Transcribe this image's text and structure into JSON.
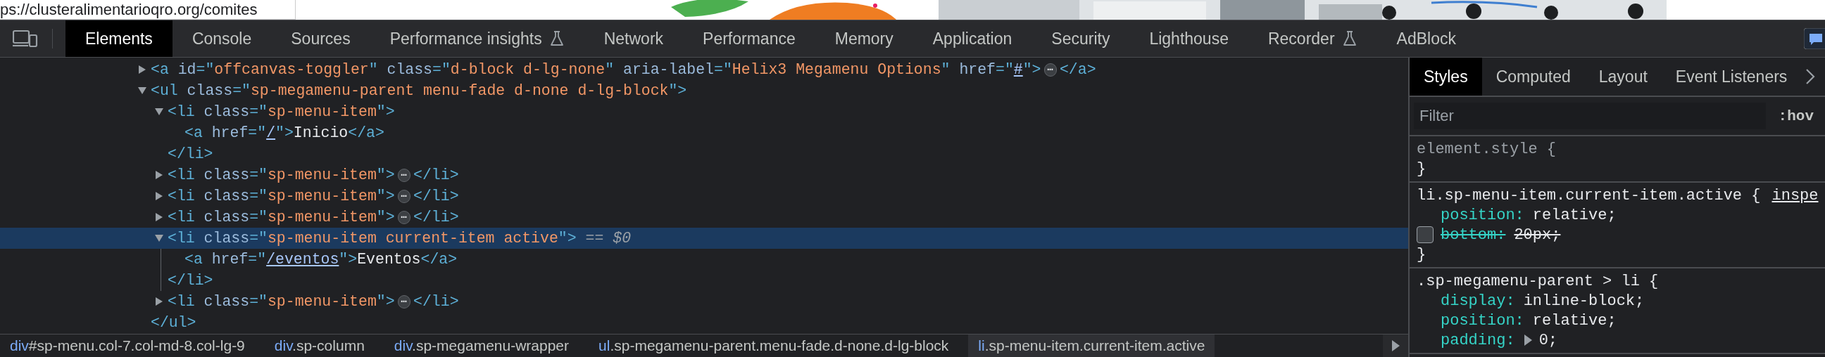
{
  "web_page": {
    "url_tooltip": "ps://clusteralimentarioqro.org/comites"
  },
  "toolbar": {
    "tabs": [
      {
        "label": "Elements",
        "selected": true,
        "experimental": false
      },
      {
        "label": "Console",
        "selected": false,
        "experimental": false
      },
      {
        "label": "Sources",
        "selected": false,
        "experimental": false
      },
      {
        "label": "Performance insights",
        "selected": false,
        "experimental": true
      },
      {
        "label": "Network",
        "selected": false,
        "experimental": false
      },
      {
        "label": "Performance",
        "selected": false,
        "experimental": false
      },
      {
        "label": "Memory",
        "selected": false,
        "experimental": false
      },
      {
        "label": "Application",
        "selected": false,
        "experimental": false
      },
      {
        "label": "Security",
        "selected": false,
        "experimental": false
      },
      {
        "label": "Lighthouse",
        "selected": false,
        "experimental": false
      },
      {
        "label": "Recorder",
        "selected": false,
        "experimental": true
      },
      {
        "label": "AdBlock",
        "selected": false,
        "experimental": false
      }
    ]
  },
  "elements_tree": [
    {
      "line": [
        {
          "kind": "tag",
          "text": "<a"
        },
        {
          "kind": "attr",
          "text": " id"
        },
        {
          "kind": "tag",
          "text": "=\""
        },
        {
          "kind": "val",
          "text": "offcanvas-toggler"
        },
        {
          "kind": "tag",
          "text": "\""
        },
        {
          "kind": "attr",
          "text": " class"
        },
        {
          "kind": "tag",
          "text": "=\""
        },
        {
          "kind": "val",
          "text": "d-block d-lg-none"
        },
        {
          "kind": "tag",
          "text": "\""
        },
        {
          "kind": "attr",
          "text": " aria-label"
        },
        {
          "kind": "tag",
          "text": "=\""
        },
        {
          "kind": "val",
          "text": "Helix3 Megamenu Options"
        },
        {
          "kind": "tag",
          "text": "\""
        },
        {
          "kind": "attr",
          "text": " href"
        },
        {
          "kind": "tag",
          "text": "=\""
        },
        {
          "kind": "link",
          "text": "#"
        },
        {
          "kind": "tag",
          "text": "\">"
        },
        {
          "kind": "ellipsis",
          "text": "⋯"
        },
        {
          "kind": "tag",
          "text": "</a>"
        }
      ],
      "expanded": false,
      "selected": false
    },
    {
      "line": [
        {
          "kind": "tag",
          "text": "<ul"
        },
        {
          "kind": "attr",
          "text": " class"
        },
        {
          "kind": "tag",
          "text": "=\""
        },
        {
          "kind": "val",
          "text": "sp-megamenu-parent menu-fade d-none d-lg-block"
        },
        {
          "kind": "tag",
          "text": "\">"
        }
      ],
      "expanded": true,
      "selected": false,
      "close": [
        {
          "kind": "tag",
          "text": "</ul>"
        }
      ],
      "children": [
        {
          "line": [
            {
              "kind": "tag",
              "text": "<li"
            },
            {
              "kind": "attr",
              "text": " class"
            },
            {
              "kind": "tag",
              "text": "=\""
            },
            {
              "kind": "val",
              "text": "sp-menu-item"
            },
            {
              "kind": "tag",
              "text": "\">"
            }
          ],
          "expanded": true,
          "selected": false,
          "close": [
            {
              "kind": "tag",
              "text": "</li>"
            }
          ],
          "children": [
            {
              "line": [
                {
                  "kind": "tag",
                  "text": "<a"
                },
                {
                  "kind": "attr",
                  "text": " href"
                },
                {
                  "kind": "tag",
                  "text": "=\""
                },
                {
                  "kind": "link",
                  "text": "/"
                },
                {
                  "kind": "tag",
                  "text": "\">"
                },
                {
                  "kind": "text",
                  "text": "Inicio"
                },
                {
                  "kind": "tag",
                  "text": "</a>"
                }
              ],
              "selected": false
            }
          ]
        },
        {
          "line": [
            {
              "kind": "tag",
              "text": "<li"
            },
            {
              "kind": "attr",
              "text": " class"
            },
            {
              "kind": "tag",
              "text": "=\""
            },
            {
              "kind": "val",
              "text": "sp-menu-item"
            },
            {
              "kind": "tag",
              "text": "\">"
            },
            {
              "kind": "ellipsis",
              "text": "⋯"
            },
            {
              "kind": "tag",
              "text": "</li>"
            }
          ],
          "expanded": false,
          "selected": false
        },
        {
          "line": [
            {
              "kind": "tag",
              "text": "<li"
            },
            {
              "kind": "attr",
              "text": " class"
            },
            {
              "kind": "tag",
              "text": "=\""
            },
            {
              "kind": "val",
              "text": "sp-menu-item"
            },
            {
              "kind": "tag",
              "text": "\">"
            },
            {
              "kind": "ellipsis",
              "text": "⋯"
            },
            {
              "kind": "tag",
              "text": "</li>"
            }
          ],
          "expanded": false,
          "selected": false
        },
        {
          "line": [
            {
              "kind": "tag",
              "text": "<li"
            },
            {
              "kind": "attr",
              "text": " class"
            },
            {
              "kind": "tag",
              "text": "=\""
            },
            {
              "kind": "val",
              "text": "sp-menu-item"
            },
            {
              "kind": "tag",
              "text": "\">"
            },
            {
              "kind": "ellipsis",
              "text": "⋯"
            },
            {
              "kind": "tag",
              "text": "</li>"
            }
          ],
          "expanded": false,
          "selected": false
        },
        {
          "line": [
            {
              "kind": "tag",
              "text": "<li"
            },
            {
              "kind": "attr",
              "text": " class"
            },
            {
              "kind": "tag",
              "text": "=\""
            },
            {
              "kind": "val",
              "text": "sp-menu-item current-item active"
            },
            {
              "kind": "tag",
              "text": "\">"
            },
            {
              "kind": "marker",
              "text": " == "
            },
            {
              "kind": "marker_var",
              "text": "$0"
            }
          ],
          "expanded": true,
          "selected": true,
          "close": [
            {
              "kind": "tag",
              "text": "</li>"
            }
          ],
          "children": [
            {
              "line": [
                {
                  "kind": "tag",
                  "text": "<a"
                },
                {
                  "kind": "attr",
                  "text": " href"
                },
                {
                  "kind": "tag",
                  "text": "=\""
                },
                {
                  "kind": "link",
                  "text": "/eventos"
                },
                {
                  "kind": "tag",
                  "text": "\">"
                },
                {
                  "kind": "text",
                  "text": "Eventos"
                },
                {
                  "kind": "tag",
                  "text": "</a>"
                }
              ],
              "selected": false
            }
          ]
        },
        {
          "line": [
            {
              "kind": "tag",
              "text": "<li"
            },
            {
              "kind": "attr",
              "text": " class"
            },
            {
              "kind": "tag",
              "text": "=\""
            },
            {
              "kind": "val",
              "text": "sp-menu-item"
            },
            {
              "kind": "tag",
              "text": "\">"
            },
            {
              "kind": "ellipsis",
              "text": "⋯"
            },
            {
              "kind": "tag",
              "text": "</li>"
            }
          ],
          "expanded": false,
          "selected": false
        }
      ]
    }
  ],
  "breadcrumbs": [
    {
      "tag": "div",
      "rest": "#sp-menu.col-7.col-md-8.col-lg-9",
      "selected": false
    },
    {
      "tag": "div",
      "rest": ".sp-column",
      "selected": false
    },
    {
      "tag": "div",
      "rest": ".sp-megamenu-wrapper",
      "selected": false
    },
    {
      "tag": "ul",
      "rest": ".sp-megamenu-parent.menu-fade.d-none.d-lg-block",
      "selected": false
    },
    {
      "tag": "li",
      "rest": ".sp-menu-item.current-item.active",
      "selected": true
    }
  ],
  "styles_pane": {
    "tabs": [
      {
        "label": "Styles",
        "selected": true
      },
      {
        "label": "Computed",
        "selected": false
      },
      {
        "label": "Layout",
        "selected": false
      },
      {
        "label": "Event Listeners",
        "selected": false
      }
    ],
    "filter": {
      "placeholder": "Filter"
    },
    "hover_toggle": ":hov",
    "rules": [
      {
        "kind": "inline",
        "selector": "element.style",
        "open": "{",
        "close": "}"
      },
      {
        "kind": "rule",
        "selector": "li.sp-menu-item.current-item.active",
        "open": "{",
        "source": "inspe",
        "close": "}",
        "declarations": [
          {
            "name": "position",
            "colon": ":",
            "value": "relative;",
            "enabled": true,
            "expandable": false
          },
          {
            "name": "bottom",
            "colon": ":",
            "value": "20px;",
            "enabled": false,
            "expandable": false
          }
        ]
      },
      {
        "kind": "rule",
        "selector": ".sp-megamenu-parent > li",
        "open": "{",
        "declarations": [
          {
            "name": "display",
            "colon": ":",
            "value": "inline-block;",
            "enabled": true,
            "expandable": false
          },
          {
            "name": "position",
            "colon": ":",
            "value": "relative;",
            "enabled": true,
            "expandable": false
          },
          {
            "name": "padding",
            "colon": ":",
            "value": "0;",
            "enabled": true,
            "expandable": true
          }
        ]
      }
    ]
  }
}
